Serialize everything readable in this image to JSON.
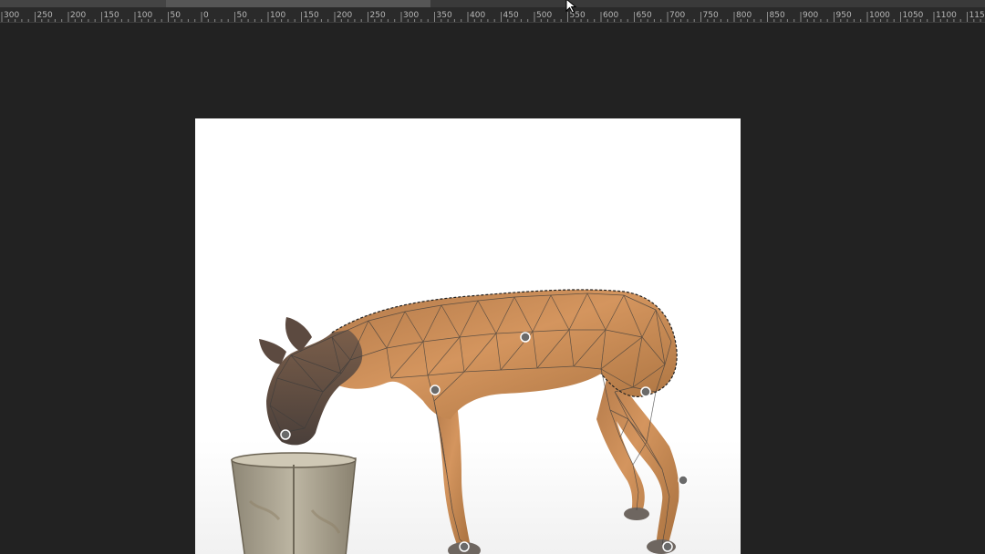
{
  "tabs": {
    "left_label": "",
    "active_label": "",
    "right_label": ""
  },
  "ruler": {
    "unit": "px",
    "labels": [
      "300",
      "250",
      "200",
      "150",
      "100",
      "50",
      "0",
      "50",
      "100",
      "150",
      "200",
      "250",
      "300",
      "350",
      "400",
      "450",
      "500",
      "550",
      "600",
      "650",
      "700",
      "750",
      "800",
      "850",
      "900",
      "950",
      "1000",
      "1050",
      "1100",
      "115"
    ]
  },
  "canvas": {
    "image": "dog-drinking-from-bucket",
    "overlay": "puppet-warp-mesh",
    "pin_count": 7,
    "colors": {
      "background": "#222222",
      "canvas": "#ffffff",
      "dog_fur": "#c98a55",
      "mesh": "#3b3b3b",
      "bucket": "#a39c8a"
    }
  }
}
